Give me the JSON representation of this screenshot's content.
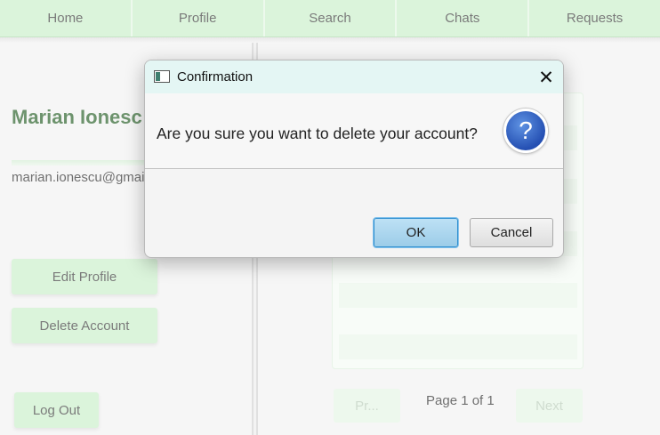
{
  "nav": {
    "items": [
      {
        "label": "Home"
      },
      {
        "label": "Profile"
      },
      {
        "label": "Search"
      },
      {
        "label": "Chats"
      },
      {
        "label": "Requests"
      }
    ]
  },
  "profile": {
    "name": "Marian Ionesc",
    "email": "marian.ionescu@gmai",
    "edit_label": "Edit Profile",
    "delete_label": "Delete Account",
    "logout_label": "Log Out"
  },
  "pager": {
    "prev_label": "Pr...",
    "page_info": "Page 1 of 1",
    "next_label": "Next"
  },
  "dialog": {
    "title": "Confirmation",
    "message": "Are you sure you want to delete your account?",
    "ok_label": "OK",
    "cancel_label": "Cancel",
    "help_icon": "?",
    "close_icon": "✕"
  },
  "colors": {
    "accent_green": "#c8eec8",
    "dialog_titlebar": "#e4f6f4",
    "ok_button": "#9ccce8"
  }
}
